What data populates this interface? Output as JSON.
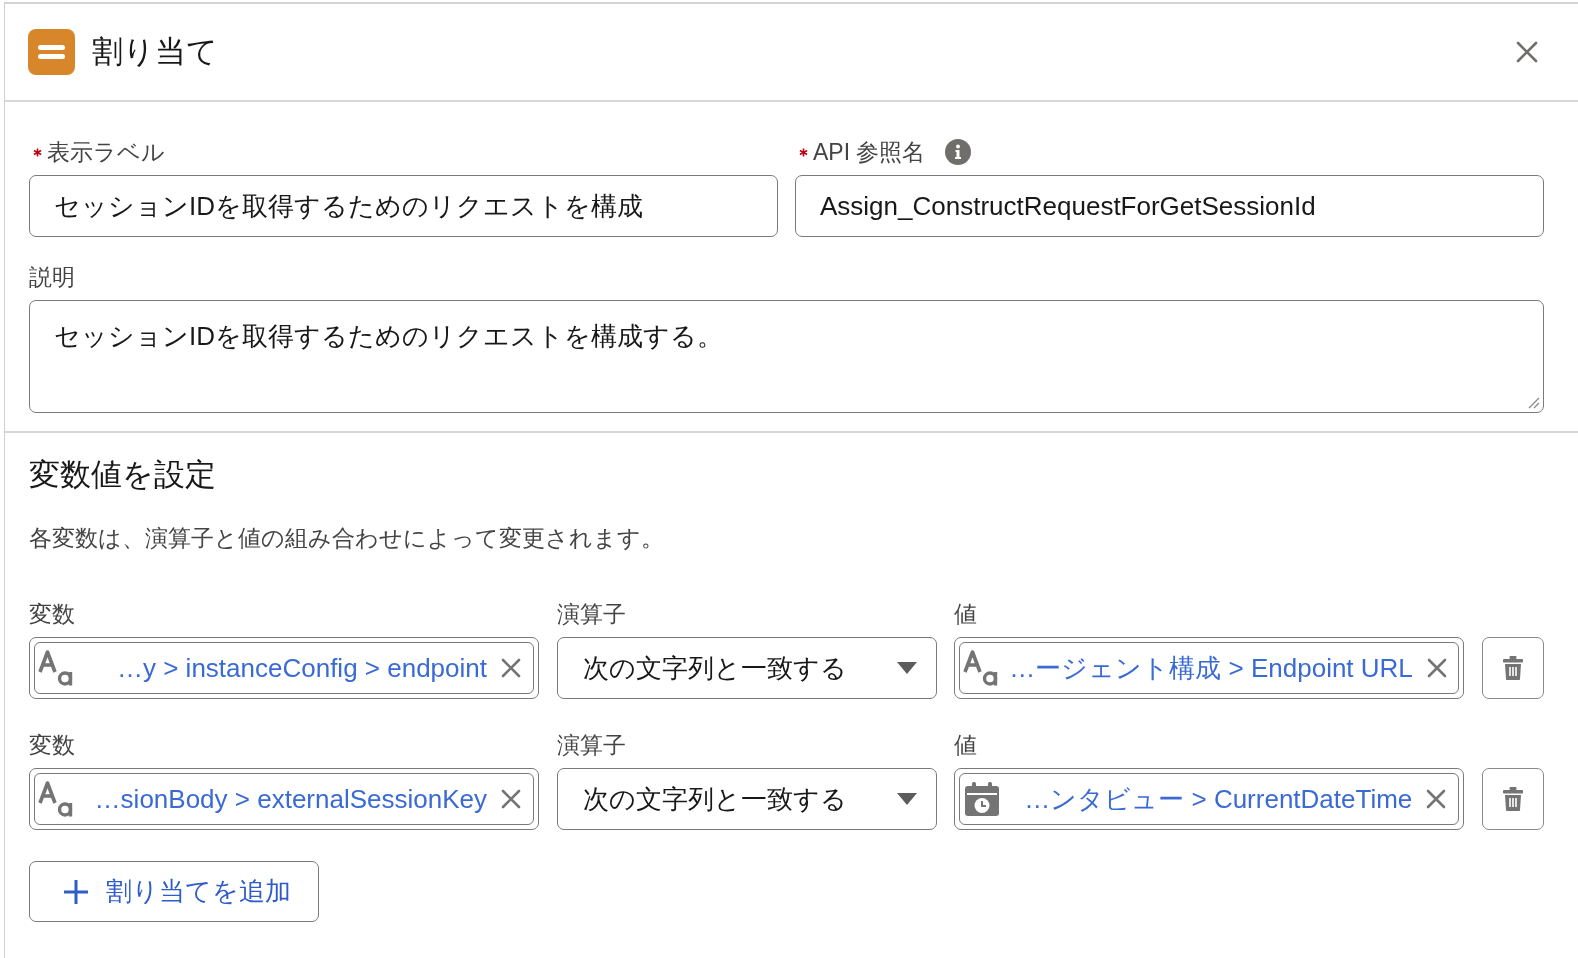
{
  "dialog": {
    "title": "割り当て"
  },
  "fields": [
    {
      "label": "表示ラベル",
      "required": true,
      "info": false,
      "value": "セッションIDを取得するためのリクエストを構成"
    },
    {
      "label": "API 参照名",
      "required": true,
      "info": true,
      "value": "Assign_ConstructRequestForGetSessionId"
    }
  ],
  "description": {
    "label": "説明",
    "value": "セッションIDを取得するためのリクエストを構成する。"
  },
  "section": {
    "title": "変数値を設定",
    "text": "各変数は、演算子と値の組み合わせによって変更されます。"
  },
  "assignments": [
    {
      "variable": {
        "label": "変数",
        "kind": "text",
        "value": "…y > instanceConfig > endpoint"
      },
      "operator": {
        "label": "演算子",
        "value": "次の文字列と一致する"
      },
      "value": {
        "label": "値",
        "kind": "text",
        "value": "…ージェント構成 > Endpoint URL"
      }
    },
    {
      "variable": {
        "label": "変数",
        "kind": "text",
        "value": "…sionBody > externalSessionKey"
      },
      "operator": {
        "label": "演算子",
        "value": "次の文字列と一致する"
      },
      "value": {
        "label": "値",
        "kind": "datetime",
        "value": "…ンタビュー > CurrentDateTime"
      }
    }
  ],
  "add_button": {
    "label": "割り当てを追加"
  }
}
